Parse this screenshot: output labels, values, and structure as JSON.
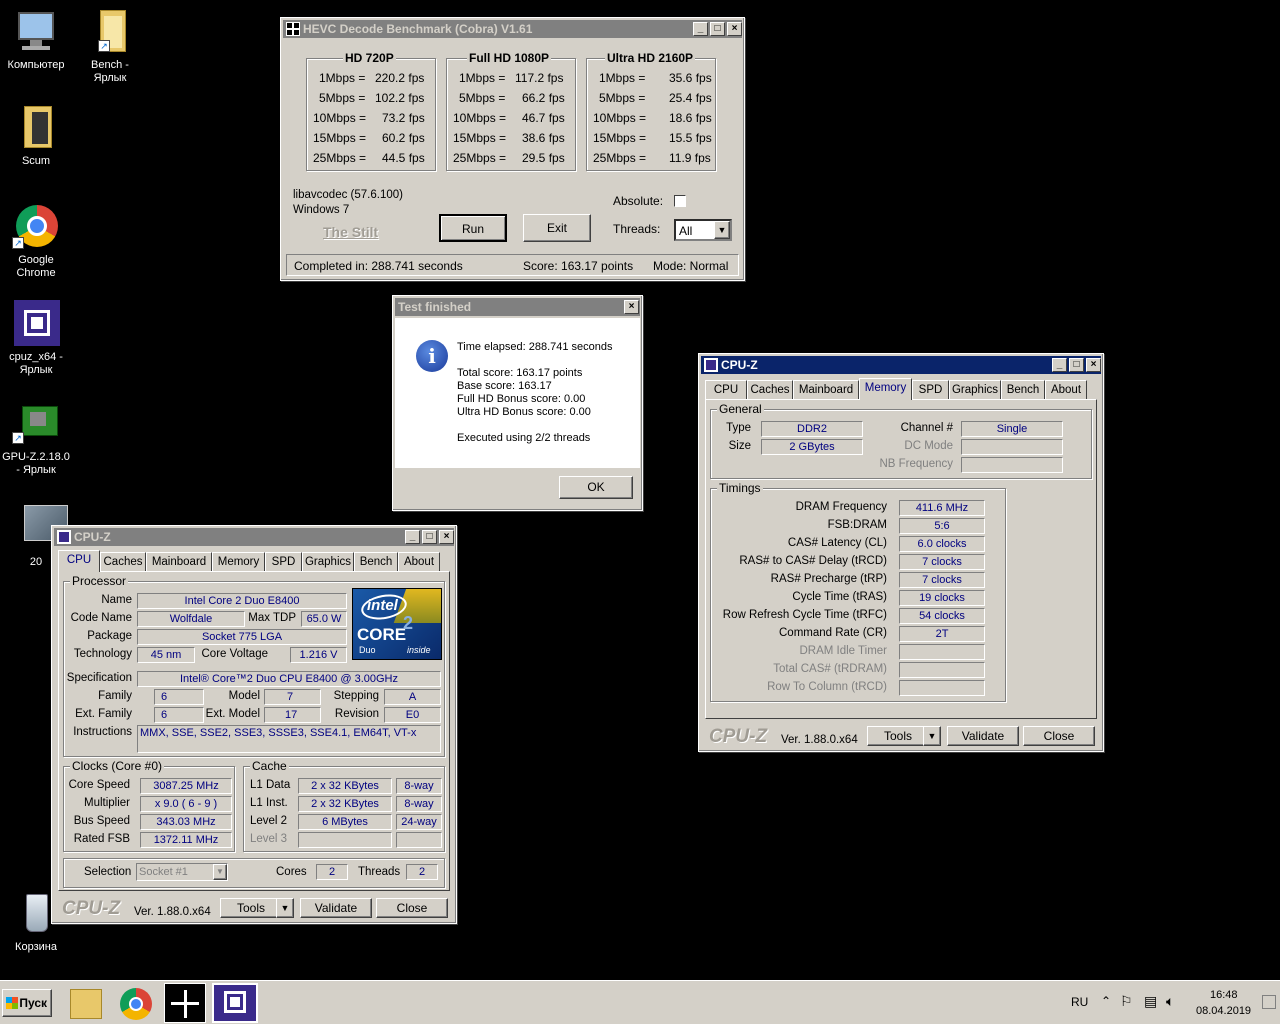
{
  "desktop": {
    "icons": [
      {
        "name": "computer",
        "label": "Компьютер"
      },
      {
        "name": "bench",
        "label": "Bench -\nЯрлык"
      },
      {
        "name": "scum",
        "label": "Scum"
      },
      {
        "name": "chrome",
        "label": "Google\nChrome"
      },
      {
        "name": "cpuz",
        "label": "cpuz_x64 -\nЯрлык"
      },
      {
        "name": "gpuz",
        "label": "GPU-Z.2.18.0\n- Ярлык"
      },
      {
        "name": "twenty",
        "label": "20"
      },
      {
        "name": "recycle",
        "label": "Корзина"
      }
    ]
  },
  "hevc": {
    "title": "HEVC Decode Benchmark (Cobra) V1.61",
    "groups": [
      {
        "title": "HD 720P",
        "rows": [
          [
            "1Mbps =",
            "220.2 fps"
          ],
          [
            "5Mbps =",
            "102.2 fps"
          ],
          [
            "10Mbps =",
            "73.2 fps"
          ],
          [
            "15Mbps =",
            "60.2 fps"
          ],
          [
            "25Mbps =",
            "44.5 fps"
          ]
        ]
      },
      {
        "title": "Full HD 1080P",
        "rows": [
          [
            "1Mbps =",
            "117.2 fps"
          ],
          [
            "5Mbps =",
            "66.2 fps"
          ],
          [
            "10Mbps =",
            "46.7 fps"
          ],
          [
            "15Mbps =",
            "38.6 fps"
          ],
          [
            "25Mbps =",
            "29.5 fps"
          ]
        ]
      },
      {
        "title": "Ultra HD 2160P",
        "rows": [
          [
            "1Mbps =",
            "35.6 fps"
          ],
          [
            "5Mbps =",
            "25.4 fps"
          ],
          [
            "10Mbps =",
            "18.6 fps"
          ],
          [
            "15Mbps =",
            "15.5 fps"
          ],
          [
            "25Mbps =",
            "11.9 fps"
          ]
        ]
      }
    ],
    "libav": "libavcodec (57.6.100)",
    "os": "Windows 7",
    "author": "The Stilt",
    "run": "Run",
    "exit": "Exit",
    "absolute": "Absolute:",
    "threads_label": "Threads:",
    "threads_value": "All",
    "status_completed": "Completed in: 288.741 seconds",
    "status_score": "Score: 163.17 points",
    "status_mode": "Mode: Normal"
  },
  "dialog": {
    "title": "Test finished",
    "lines": [
      "Time elapsed:  288.741 seconds",
      "",
      "Total score:  163.17 points",
      "Base score: 163.17",
      "Full HD Bonus score: 0.00",
      "Ultra HD Bonus score: 0.00",
      "",
      "Executed using 2/2 threads"
    ],
    "ok": "OK"
  },
  "cpuz_tabs": [
    "CPU",
    "Caches",
    "Mainboard",
    "Memory",
    "SPD",
    "Graphics",
    "Bench",
    "About"
  ],
  "cpuz_title": "CPU-Z",
  "cpuz_logo": "CPU-Z",
  "cpuz_version": "Ver. 1.88.0.x64",
  "cpuz_buttons": {
    "tools": "Tools",
    "validate": "Validate",
    "close": "Close"
  },
  "cpu": {
    "processor_group": "Processor",
    "name_l": "Name",
    "name": "Intel Core 2 Duo E8400",
    "code_l": "Code Name",
    "code": "Wolfdale",
    "tdp_l": "Max TDP",
    "tdp": "65.0 W",
    "pkg_l": "Package",
    "pkg": "Socket 775 LGA",
    "tech_l": "Technology",
    "tech": "45 nm",
    "volt_l": "Core Voltage",
    "volt": "1.216 V",
    "spec_l": "Specification",
    "spec": "Intel® Core™2 Duo CPU     E8400  @ 3.00GHz",
    "family_l": "Family",
    "family": "6",
    "model_l": "Model",
    "model": "7",
    "stepping_l": "Stepping",
    "stepping": "A",
    "extfam_l": "Ext. Family",
    "extfam": "6",
    "extmod_l": "Ext. Model",
    "extmod": "17",
    "rev_l": "Revision",
    "rev": "E0",
    "instr_l": "Instructions",
    "instr": "MMX, SSE, SSE2, SSE3, SSSE3, SSE4.1, EM64T, VT-x",
    "clocks_group": "Clocks (Core #0)",
    "cs_l": "Core Speed",
    "cs": "3087.25 MHz",
    "mult_l": "Multiplier",
    "mult": "x 9.0 ( 6 - 9 )",
    "bus_l": "Bus Speed",
    "bus": "343.03 MHz",
    "fsb_l": "Rated FSB",
    "fsb": "1372.11 MHz",
    "cache_group": "Cache",
    "l1d_l": "L1 Data",
    "l1d": "2 x 32 KBytes",
    "l1d_w": "8-way",
    "l1i_l": "L1 Inst.",
    "l1i": "2 x 32 KBytes",
    "l1i_w": "8-way",
    "l2_l": "Level 2",
    "l2": "6 MBytes",
    "l2_w": "24-way",
    "l3_l": "Level 3",
    "sel_l": "Selection",
    "sel": "Socket #1",
    "cores_l": "Cores",
    "cores": "2",
    "threads_l": "Threads",
    "threads": "2",
    "intel_logo": {
      "brand": "intel",
      "line": "CORE",
      "sub": "Duo",
      "num": "2",
      "inside": "inside"
    }
  },
  "mem": {
    "general_group": "General",
    "type_l": "Type",
    "type": "DDR2",
    "size_l": "Size",
    "size": "2 GBytes",
    "chan_l": "Channel #",
    "chan": "Single",
    "dc_l": "DC Mode",
    "nb_l": "NB Frequency",
    "timings_group": "Timings",
    "timings": [
      {
        "l": "DRAM Frequency",
        "v": "411.6 MHz"
      },
      {
        "l": "FSB:DRAM",
        "v": "5:6"
      },
      {
        "l": "CAS# Latency (CL)",
        "v": "6.0 clocks"
      },
      {
        "l": "RAS# to CAS# Delay (tRCD)",
        "v": "7 clocks"
      },
      {
        "l": "RAS# Precharge (tRP)",
        "v": "7 clocks"
      },
      {
        "l": "Cycle Time (tRAS)",
        "v": "19 clocks"
      },
      {
        "l": "Row Refresh Cycle Time (tRFC)",
        "v": "54 clocks"
      },
      {
        "l": "Command Rate (CR)",
        "v": "2T"
      },
      {
        "l": "DRAM Idle Timer",
        "v": ""
      },
      {
        "l": "Total CAS# (tRDRAM)",
        "v": ""
      },
      {
        "l": "Row To Column (tRCD)",
        "v": ""
      }
    ]
  },
  "taskbar": {
    "start": "Пуск",
    "lang": "RU",
    "time": "16:48",
    "date": "08.04.2019"
  }
}
